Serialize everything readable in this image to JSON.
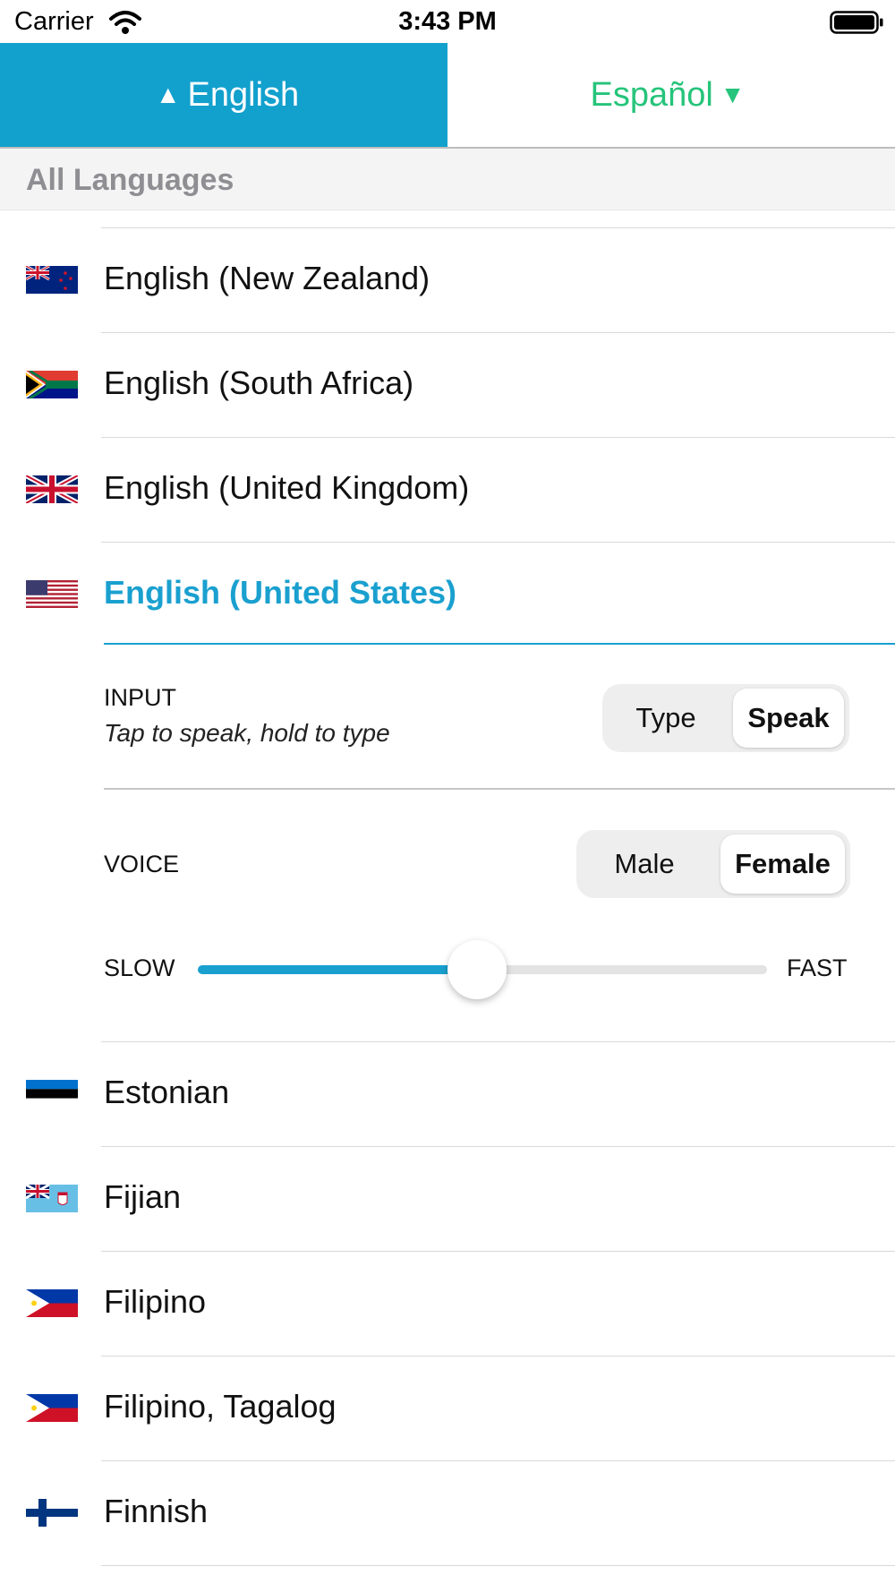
{
  "status_bar": {
    "carrier": "Carrier",
    "time": "3:43 PM"
  },
  "tabs": {
    "source": {
      "label": "English",
      "glyph": "▲"
    },
    "target": {
      "label": "Español",
      "glyph": "▼"
    }
  },
  "section": {
    "title": "All Languages"
  },
  "languages_above": [
    {
      "label": "English (New Zealand)",
      "flag": "nz-flag-icon"
    },
    {
      "label": "English (South Africa)",
      "flag": "za-flag-icon"
    },
    {
      "label": "English (United Kingdom)",
      "flag": "uk-flag-icon"
    }
  ],
  "selected_language": {
    "label": "English (United States)",
    "flag": "us-flag-icon"
  },
  "settings": {
    "input": {
      "title": "INPUT",
      "hint": "Tap to speak, hold to type",
      "options": [
        "Type",
        "Speak"
      ],
      "selected": "Speak"
    },
    "voice": {
      "title": "VOICE",
      "options": [
        "Male",
        "Female"
      ],
      "selected": "Female"
    },
    "speed": {
      "slow_label": "SLOW",
      "fast_label": "FAST",
      "value": 0.49
    }
  },
  "languages_below": [
    {
      "label": "Estonian",
      "flag": "ee-flag-icon"
    },
    {
      "label": "Fijian",
      "flag": "fj-flag-icon"
    },
    {
      "label": "Filipino",
      "flag": "ph-flag-icon"
    },
    {
      "label": "Filipino, Tagalog",
      "flag": "ph-flag-icon"
    },
    {
      "label": "Finnish",
      "flag": "fi-flag-icon"
    }
  ],
  "colors": {
    "accent": "#1aa0cf",
    "tab_active_bg": "#12a0cd",
    "target_text": "#25c47a"
  }
}
